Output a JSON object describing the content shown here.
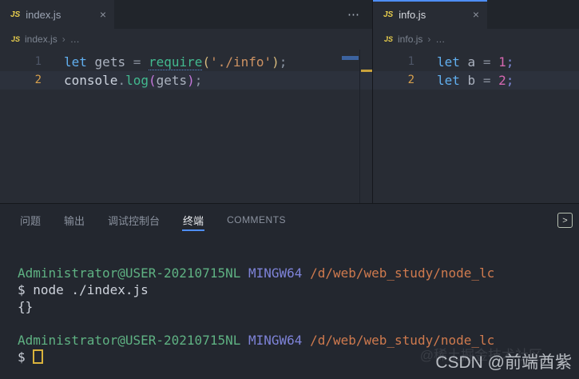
{
  "colors": {
    "accent_blue": "#4e8ef7",
    "editor_bg": "#282c34",
    "tabbar_bg": "#21252b",
    "panel_bg": "#23272f",
    "current_line_bg": "#2c313c",
    "terminal_cursor": "#d9b23c",
    "prompt_user_green": "#5fb283",
    "prompt_shell_violet": "#7e83d8",
    "prompt_path_orange": "#cf7a4e"
  },
  "editors": [
    {
      "tab": {
        "icon": "JS",
        "label": "index.js",
        "close": "×"
      },
      "more_actions": "⋯",
      "breadcrumb": {
        "icon": "JS",
        "file": "index.js",
        "sep": "›",
        "rest": "…"
      },
      "lines": [
        {
          "num": "1",
          "active": false,
          "tokens": [
            {
              "t": "let",
              "c": "kw"
            },
            {
              "t": " ",
              "c": "id"
            },
            {
              "t": "gets",
              "c": "id"
            },
            {
              "t": " ",
              "c": "id"
            },
            {
              "t": "=",
              "c": "op"
            },
            {
              "t": " ",
              "c": "id"
            },
            {
              "t": "require",
              "c": "fn",
              "u": true
            },
            {
              "t": "(",
              "c": "pg"
            },
            {
              "t": "'./info'",
              "c": "str"
            },
            {
              "t": ")",
              "c": "pg"
            },
            {
              "t": ";",
              "c": "pun"
            }
          ]
        },
        {
          "num": "2",
          "active": true,
          "tokens": [
            {
              "t": "console",
              "c": "con"
            },
            {
              "t": ".",
              "c": "pun"
            },
            {
              "t": "log",
              "c": "fn"
            },
            {
              "t": "(",
              "c": "pp"
            },
            {
              "t": "gets",
              "c": "id"
            },
            {
              "t": ")",
              "c": "pp"
            },
            {
              "t": ";",
              "c": "pun"
            }
          ]
        }
      ]
    },
    {
      "tab": {
        "icon": "JS",
        "label": "info.js",
        "close": "×"
      },
      "breadcrumb": {
        "icon": "JS",
        "file": "info.js",
        "sep": "›",
        "rest": "…"
      },
      "lines": [
        {
          "num": "1",
          "active": false,
          "tokens": [
            {
              "t": "let",
              "c": "kw"
            },
            {
              "t": " ",
              "c": "id"
            },
            {
              "t": "a",
              "c": "id"
            },
            {
              "t": " ",
              "c": "id"
            },
            {
              "t": "=",
              "c": "op"
            },
            {
              "t": " ",
              "c": "id"
            },
            {
              "t": "1",
              "c": "num"
            },
            {
              "t": ";",
              "c": "semi2"
            }
          ]
        },
        {
          "num": "2",
          "active": true,
          "tokens": [
            {
              "t": "let",
              "c": "kw"
            },
            {
              "t": " ",
              "c": "id"
            },
            {
              "t": "b",
              "c": "id"
            },
            {
              "t": " ",
              "c": "id"
            },
            {
              "t": "=",
              "c": "op"
            },
            {
              "t": " ",
              "c": "id"
            },
            {
              "t": "2",
              "c": "num"
            },
            {
              "t": ";",
              "c": "semi2"
            }
          ]
        }
      ]
    }
  ],
  "panel": {
    "tabs": [
      {
        "name": "panel-tab-problems",
        "label": "问题",
        "active": false
      },
      {
        "name": "panel-tab-output",
        "label": "输出",
        "active": false
      },
      {
        "name": "panel-tab-debug-console",
        "label": "调试控制台",
        "active": false
      },
      {
        "name": "panel-tab-terminal",
        "label": "终端",
        "active": true
      },
      {
        "name": "panel-tab-comments",
        "label": "COMMENTS",
        "active": false,
        "caps": true
      }
    ],
    "expand_icon": ">",
    "terminal": {
      "lines": [
        {
          "tokens": [
            {
              "t": "Administrator@USER-20210715NL",
              "c": "green"
            },
            {
              "t": " ",
              "c": "fg"
            },
            {
              "t": "MINGW64",
              "c": "violet"
            },
            {
              "t": " ",
              "c": "fg"
            },
            {
              "t": "/d/web/web_study/node_lc",
              "c": "orange"
            }
          ]
        },
        {
          "tokens": [
            {
              "t": "$ node ./index.js",
              "c": "fg"
            }
          ]
        },
        {
          "tokens": [
            {
              "t": "{}",
              "c": "fg"
            }
          ]
        },
        {
          "tokens": []
        },
        {
          "tokens": [
            {
              "t": "Administrator@USER-20210715NL",
              "c": "green"
            },
            {
              "t": " ",
              "c": "fg"
            },
            {
              "t": "MINGW64",
              "c": "violet"
            },
            {
              "t": " ",
              "c": "fg"
            },
            {
              "t": "/d/web/web_study/node_lc",
              "c": "orange"
            }
          ]
        },
        {
          "tokens": [
            {
              "t": "$ ",
              "c": "fg"
            },
            {
              "t": "",
              "c": "cursor"
            }
          ]
        }
      ]
    }
  },
  "watermark": {
    "main": "CSDN @前端酋紫",
    "faint": "@稀土掘金技术社区"
  }
}
